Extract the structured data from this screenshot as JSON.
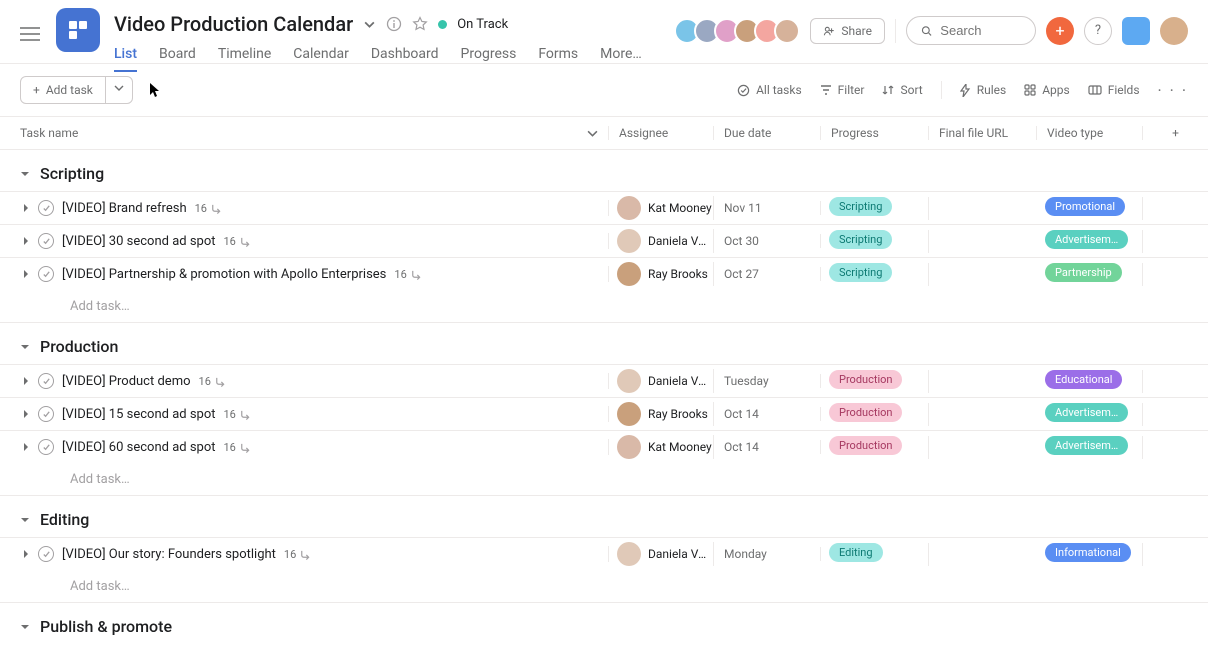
{
  "header": {
    "project_title": "Video Production Calendar",
    "status": "On Track"
  },
  "tabs": [
    "List",
    "Board",
    "Timeline",
    "Calendar",
    "Dashboard",
    "Progress",
    "Forms",
    "More…"
  ],
  "active_tab": "List",
  "topbar": {
    "share_label": "Share",
    "search_placeholder": "Search",
    "help_label": "?"
  },
  "header_avatars": [
    {
      "bg": "#7ac4e8"
    },
    {
      "bg": "#9aa8c2"
    },
    {
      "bg": "#e0a0c8"
    },
    {
      "bg": "#c9a07c"
    },
    {
      "bg": "#f4a6a0"
    },
    {
      "bg": "#d6b29a"
    }
  ],
  "toolbar": {
    "add_task_label": "Add task",
    "buttons": [
      {
        "icon": "check-all",
        "label": "All tasks"
      },
      {
        "icon": "filter",
        "label": "Filter"
      },
      {
        "icon": "sort",
        "label": "Sort"
      },
      {
        "icon": "bolt",
        "label": "Rules"
      },
      {
        "icon": "apps",
        "label": "Apps"
      },
      {
        "icon": "fields",
        "label": "Fields"
      }
    ]
  },
  "columns": [
    "Task name",
    "Assignee",
    "Due date",
    "Progress",
    "Final file URL",
    "Video type"
  ],
  "add_task_placeholder": "Add task…",
  "progress_colors": {
    "Scripting": {
      "bg": "#9ee7e3",
      "fg": "#0d7a73"
    },
    "Production": {
      "bg": "#f8c8d6",
      "fg": "#a53860"
    },
    "Editing": {
      "bg": "#9ee7e3",
      "fg": "#0d7a73"
    }
  },
  "type_colors": {
    "Promotional": {
      "bg": "#5a8ef3",
      "fg": "#ffffff"
    },
    "Advertisement": {
      "bg": "#5ad0c0",
      "fg": "#ffffff",
      "display": "Advertisem…"
    },
    "Partnership": {
      "bg": "#72d49a",
      "fg": "#ffffff"
    },
    "Educational": {
      "bg": "#9b6ee8",
      "fg": "#ffffff"
    },
    "Informational": {
      "bg": "#5a8ef3",
      "fg": "#ffffff"
    }
  },
  "assignee_colors": {
    "Kat Mooney": "#d9b9a8",
    "Daniela Vargas": "#e0c9b8",
    "Ray Brooks": "#c9a07c"
  },
  "sections": [
    {
      "name": "Scripting",
      "tasks": [
        {
          "name": "[VIDEO] Brand refresh",
          "subtasks": 16,
          "assignee": "Kat Mooney",
          "due": "Nov 11",
          "progress": "Scripting",
          "video_type": "Promotional"
        },
        {
          "name": "[VIDEO] 30 second ad spot",
          "subtasks": 16,
          "assignee": "Daniela Vargas",
          "assignee_display": "Daniela Var…",
          "due": "Oct 30",
          "progress": "Scripting",
          "video_type": "Advertisement"
        },
        {
          "name": "[VIDEO] Partnership & promotion with Apollo Enterprises",
          "subtasks": 16,
          "assignee": "Ray Brooks",
          "due": "Oct 27",
          "progress": "Scripting",
          "video_type": "Partnership"
        }
      ]
    },
    {
      "name": "Production",
      "tasks": [
        {
          "name": "[VIDEO] Product demo",
          "subtasks": 16,
          "assignee": "Daniela Vargas",
          "assignee_display": "Daniela Var…",
          "due": "Tuesday",
          "progress": "Production",
          "video_type": "Educational"
        },
        {
          "name": "[VIDEO] 15 second ad spot",
          "subtasks": 16,
          "assignee": "Ray Brooks",
          "due": "Oct 14",
          "progress": "Production",
          "video_type": "Advertisement"
        },
        {
          "name": "[VIDEO] 60 second ad spot",
          "subtasks": 16,
          "assignee": "Kat Mooney",
          "due": "Oct 14",
          "progress": "Production",
          "video_type": "Advertisement"
        }
      ]
    },
    {
      "name": "Editing",
      "tasks": [
        {
          "name": "[VIDEO] Our story: Founders spotlight",
          "subtasks": 16,
          "assignee": "Daniela Vargas",
          "assignee_display": "Daniela Var…",
          "due": "Monday",
          "progress": "Editing",
          "video_type": "Informational"
        }
      ]
    },
    {
      "name": "Publish & promote",
      "tasks": []
    }
  ]
}
